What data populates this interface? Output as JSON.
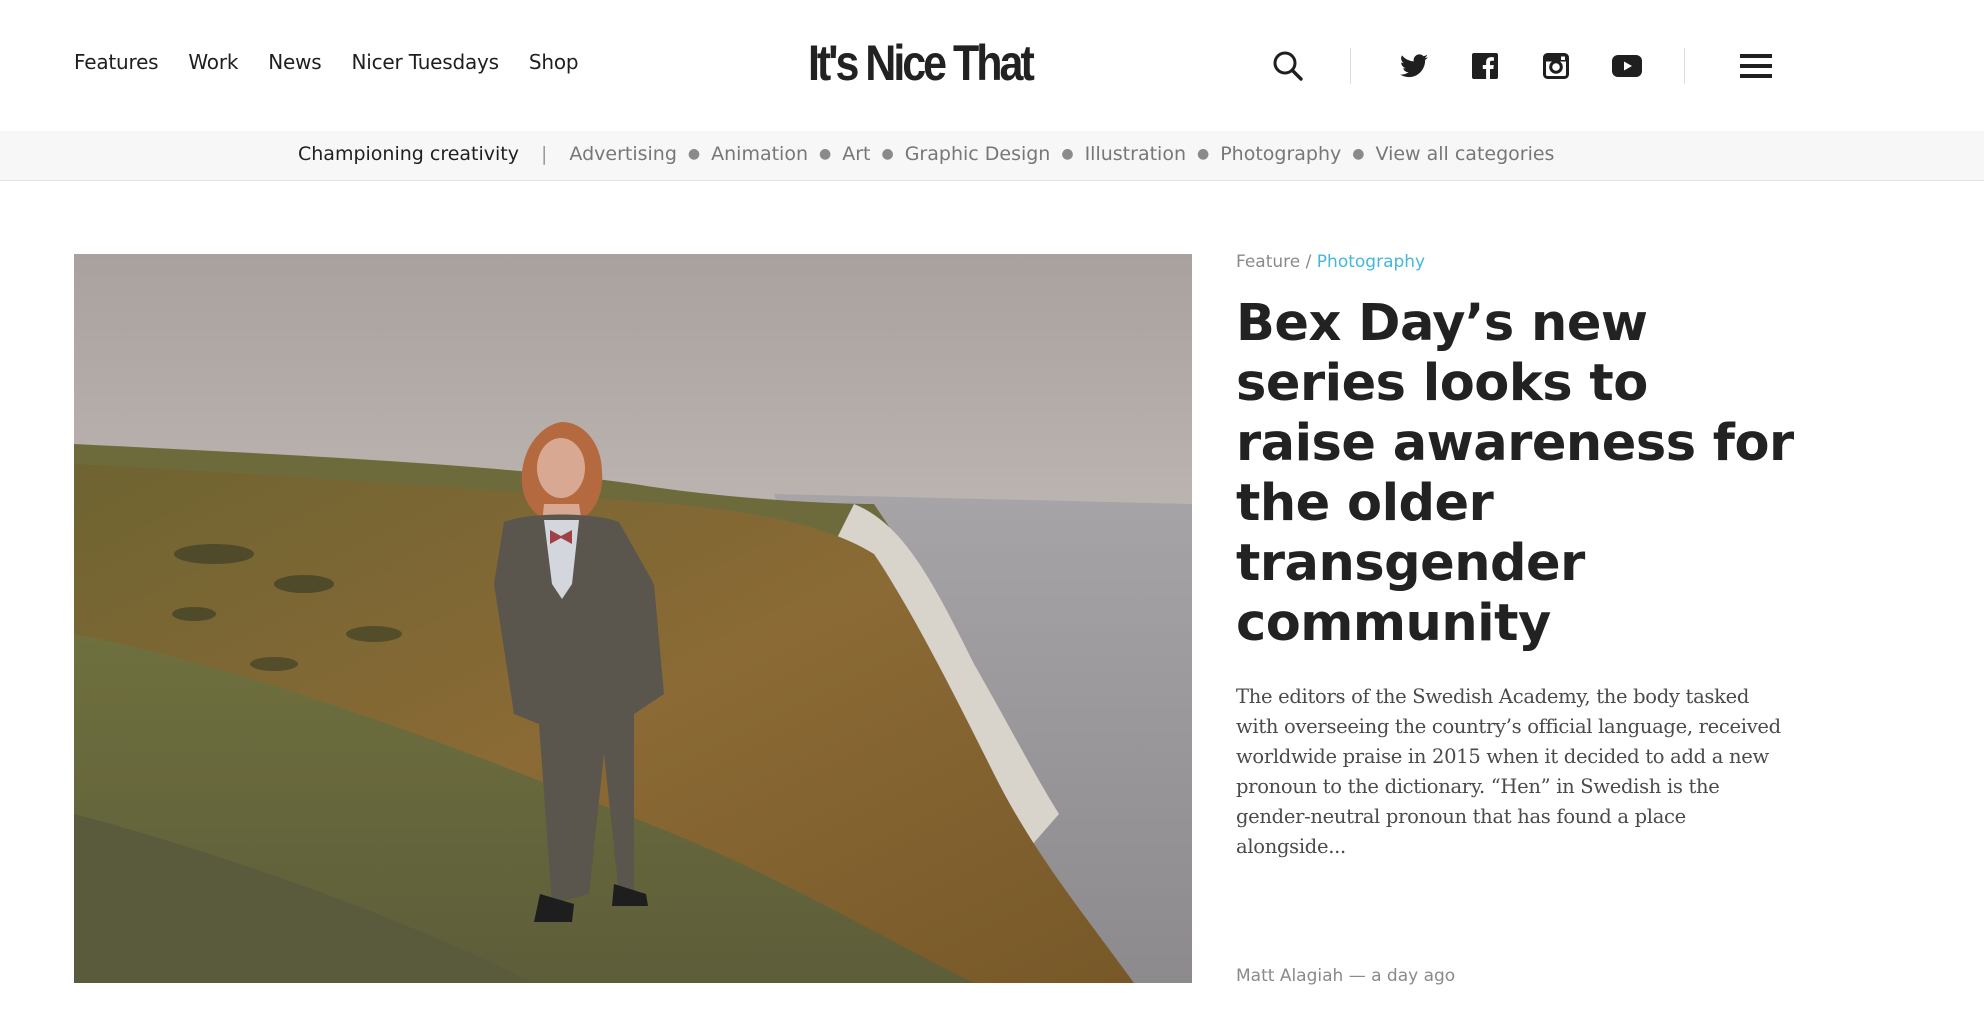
{
  "nav": {
    "items": [
      "Features",
      "Work",
      "News",
      "Nicer Tuesdays",
      "Shop"
    ]
  },
  "logo": {
    "text": "It's Nice That"
  },
  "header_icons": [
    "search-icon",
    "twitter-icon",
    "facebook-icon",
    "instagram-icon",
    "youtube-icon",
    "menu-icon"
  ],
  "subnav": {
    "tagline": "Championing creativity",
    "separator": "|",
    "categories": [
      "Advertising",
      "Animation",
      "Art",
      "Graphic Design",
      "Illustration",
      "Photography",
      "View all categories"
    ]
  },
  "article": {
    "type": "Feature",
    "slash": "/",
    "topic": "Photography",
    "headline": "Bex Day’s new series looks to raise awareness for the older transgender community",
    "standfirst": "The editors of the Swedish Academy, the body tasked with overseeing the country’s official language, received worldwide praise in 2015 when it decided to add a new pronoun to the dictionary. “Hen” in Swedish is the gender-neutral pronoun that has found a place alongside...",
    "author": "Matt Alagiah",
    "dash": "—",
    "time": "a day ago"
  },
  "colors": {
    "accent": "#43b8d8",
    "text": "#222222",
    "muted": "#8a8a8a",
    "subnav_bg": "#f7f7f7"
  }
}
